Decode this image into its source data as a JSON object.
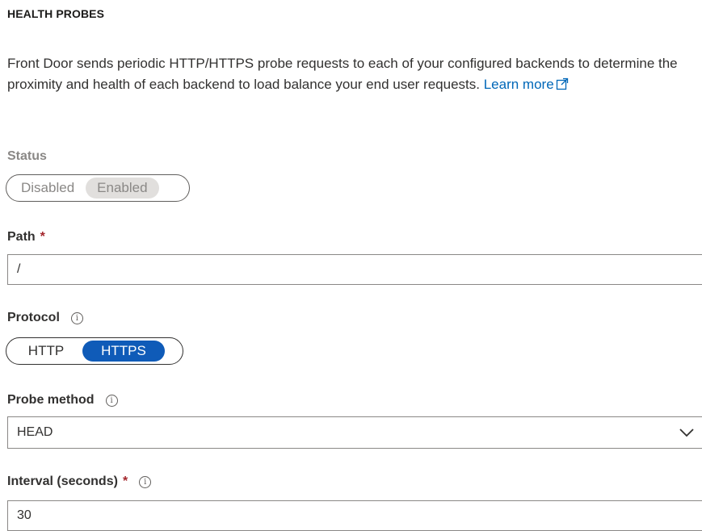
{
  "section": {
    "title": "HEALTH PROBES"
  },
  "description": {
    "text": "Front Door sends periodic HTTP/HTTPS probe requests to each of your configured backends to determine the proximity and health of each backend to load balance your end user requests.",
    "learn_more": "Learn more",
    "learn_more_icon": "external-link-icon"
  },
  "status": {
    "label": "Status",
    "options": [
      "Disabled",
      "Enabled"
    ],
    "selected": "Enabled",
    "disabled": true
  },
  "path": {
    "label": "Path",
    "required_mark": "*",
    "value": "/"
  },
  "protocol": {
    "label": "Protocol",
    "info_icon": "info-icon",
    "options": [
      "HTTP",
      "HTTPS"
    ],
    "selected": "HTTPS"
  },
  "probe_method": {
    "label": "Probe method",
    "info_icon": "info-icon",
    "value": "HEAD",
    "chevron_icon": "chevron-down-icon"
  },
  "interval": {
    "label": "Interval (seconds)",
    "required_mark": "*",
    "info_icon": "info-icon",
    "value": "30"
  },
  "colors": {
    "accent": "#0f5bb8",
    "link": "#0067b8",
    "required": "#a4262c",
    "disabled_text": "#8a8886"
  }
}
